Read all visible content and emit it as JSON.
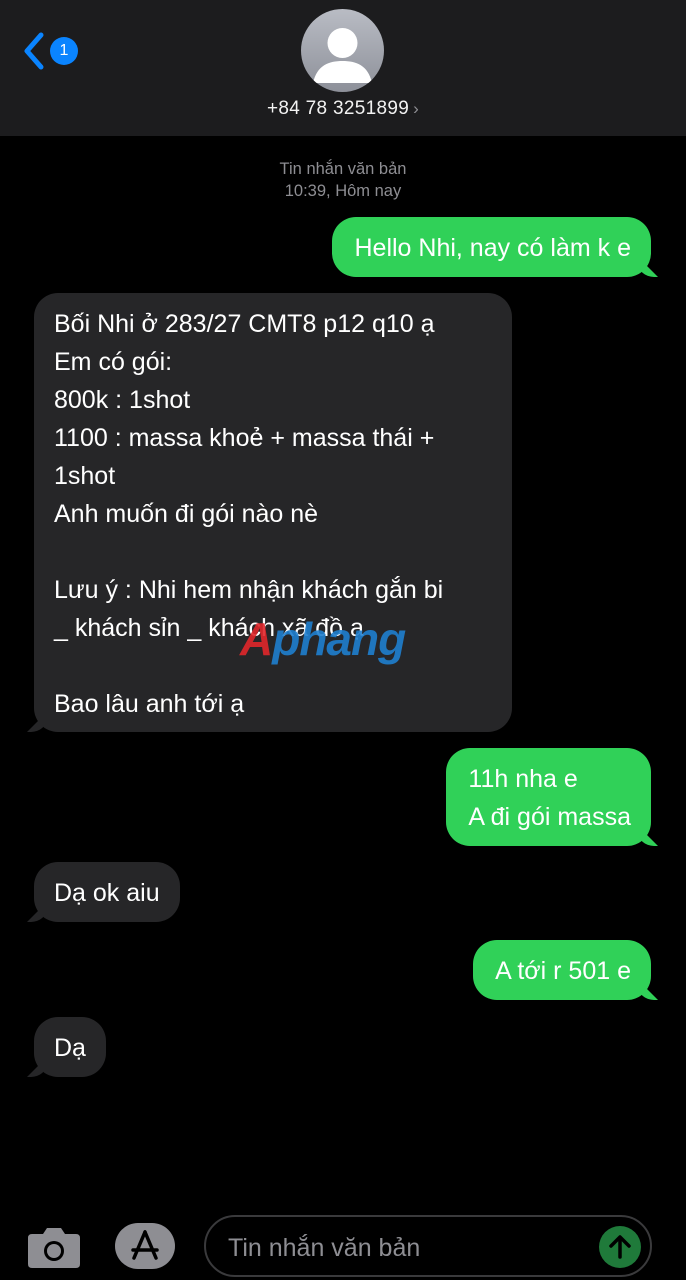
{
  "header": {
    "back_badge": "1",
    "contact_name": "+84 78 3251899",
    "contact_chevron_icon": "chevron-right-icon",
    "avatar_icon": "person-icon"
  },
  "thread": {
    "message_type": "Tin nhắn văn bản",
    "time": "10:39, Hôm nay"
  },
  "messages": [
    {
      "direction": "outgoing",
      "text": "Hello Nhi, nay có làm k e"
    },
    {
      "direction": "incoming",
      "text": "Bối Nhi ở 283/27 CMT8 p12 q10 ạ\nEm có gói:\n800k : 1shot\n1100 : massa khoẻ + massa thái +\n1shot\nAnh muốn đi gói nào nè\n\nLưu ý : Nhi hem nhận khách gắn bi\n_ khách sỉn _ khách xã đồ ạ\n\nBao lâu anh tới ạ"
    },
    {
      "direction": "outgoing",
      "text": "11h nha e\nA đi gói massa"
    },
    {
      "direction": "incoming",
      "text": "Dạ ok aiu"
    },
    {
      "direction": "outgoing",
      "text": "A tới r 501 e"
    },
    {
      "direction": "incoming",
      "text": "Dạ"
    }
  ],
  "watermark": {
    "first": "A",
    "rest": "phang"
  },
  "input_bar": {
    "placeholder": "Tin nhắn văn bản",
    "camera_icon": "camera-icon",
    "apps_icon": "app-store-icon",
    "send_icon": "arrow-up-icon"
  },
  "colors": {
    "outgoing_bubble": "#30d158",
    "incoming_bubble": "#262628",
    "accent": "#0a84ff",
    "header_bg": "#1c1c1e"
  }
}
